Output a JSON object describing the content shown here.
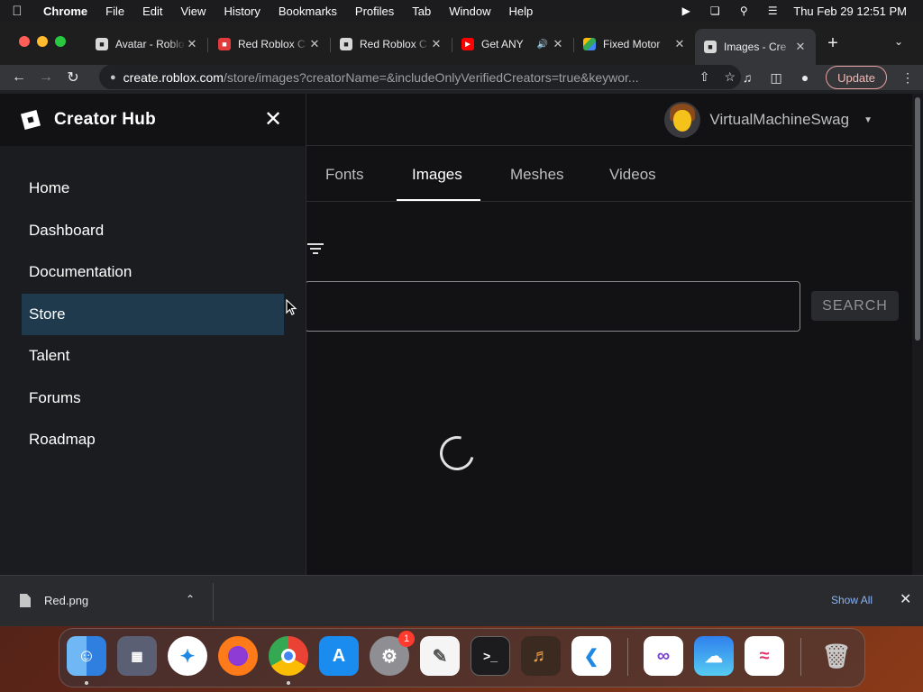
{
  "menubar": {
    "app_name": "Chrome",
    "items": [
      "File",
      "Edit",
      "View",
      "History",
      "Bookmarks",
      "Profiles",
      "Tab",
      "Window",
      "Help"
    ],
    "clock": "Thu Feb 29  12:51 PM"
  },
  "browser": {
    "tabs": [
      {
        "title": "Avatar - Roblox",
        "favicon": "roblox-icon"
      },
      {
        "title": "Red Roblox C",
        "favicon": "roblox-icon"
      },
      {
        "title": "Red Roblox C",
        "favicon": "roblox-icon"
      },
      {
        "title": "Get ANY",
        "favicon": "youtube-icon",
        "audio": true
      },
      {
        "title": "Fixed Motor",
        "favicon": "google-drive-icon"
      },
      {
        "title": "Images - Cre",
        "favicon": "roblox-icon",
        "active": true
      }
    ],
    "url_host": "create.roblox.com",
    "url_path": "/store/images?creatorName=&includeOnlyVerifiedCreators=true&keywor...",
    "update_label": "Update"
  },
  "drawer": {
    "title": "Creator Hub",
    "items": [
      "Home",
      "Dashboard",
      "Documentation",
      "Store",
      "Talent",
      "Forums",
      "Roadmap"
    ],
    "active_item": "Store"
  },
  "header": {
    "username": "VirtualMachineSwag"
  },
  "categories": {
    "tabs": [
      "Fonts",
      "Images",
      "Meshes",
      "Videos"
    ],
    "active": "Images"
  },
  "search": {
    "value": "",
    "button_label": "SEARCH"
  },
  "downloads": {
    "file_name": "Red.png",
    "show_all_label": "Show All"
  },
  "dock": {
    "apps": [
      "Finder",
      "Launchpad",
      "Safari",
      "Firefox",
      "Chrome",
      "App Store",
      "System Settings",
      "TextEdit",
      "Terminal",
      "GarageBand",
      "Visual Studio Code",
      "Visual Studio",
      "Weather",
      "Freeform",
      "Trash"
    ],
    "system_settings_badge": "1"
  },
  "colors": {
    "accent_active_nav": "#1e3a4c",
    "page_bg": "#121215",
    "update_border": "#e8a0a0"
  }
}
